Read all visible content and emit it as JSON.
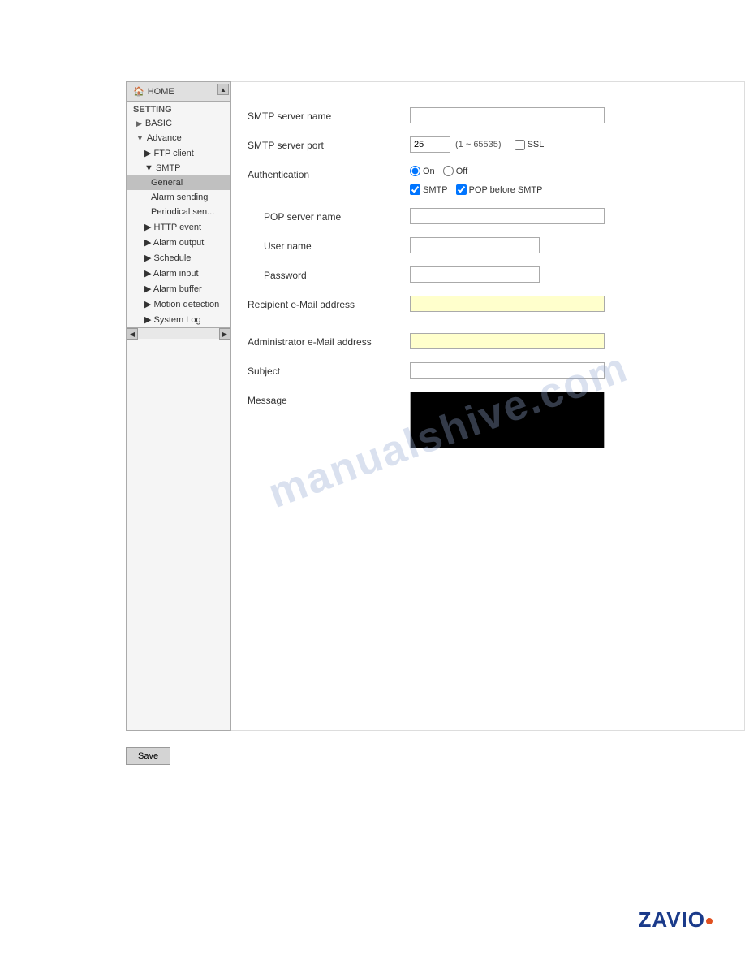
{
  "sidebar": {
    "home_label": "HOME",
    "setting_label": "SETTING",
    "basic_label": "BASIC",
    "advance_label": "Advance",
    "ftp_client_label": "FTP client",
    "smtp_label": "SMTP",
    "general_label": "General",
    "alarm_sending_label": "Alarm sending",
    "periodical_sending_label": "Periodical sen...",
    "http_event_label": "HTTP event",
    "alarm_output_label": "Alarm output",
    "schedule_label": "Schedule",
    "alarm_input_label": "Alarm input",
    "alarm_buffer_label": "Alarm buffer",
    "motion_detection_label": "Motion detection",
    "system_log_label": "System Log"
  },
  "form": {
    "smtp_server_name_label": "SMTP server name",
    "smtp_server_port_label": "SMTP server port",
    "smtp_server_port_value": "25",
    "smtp_server_port_range": "(1 ~ 65535)",
    "ssl_label": "SSL",
    "authentication_label": "Authentication",
    "auth_on_label": "On",
    "auth_off_label": "Off",
    "smtp_checkbox_label": "SMTP",
    "pop_before_smtp_label": "POP before SMTP",
    "pop_server_name_label": "POP server name",
    "user_name_label": "User name",
    "password_label": "Password",
    "recipient_email_label": "Recipient e-Mail address",
    "admin_email_label": "Administrator e-Mail address",
    "subject_label": "Subject",
    "message_label": "Message",
    "save_label": "Save"
  },
  "watermark": {
    "line1": "manualshive.com"
  },
  "logo": {
    "text": "ZAVIO"
  }
}
